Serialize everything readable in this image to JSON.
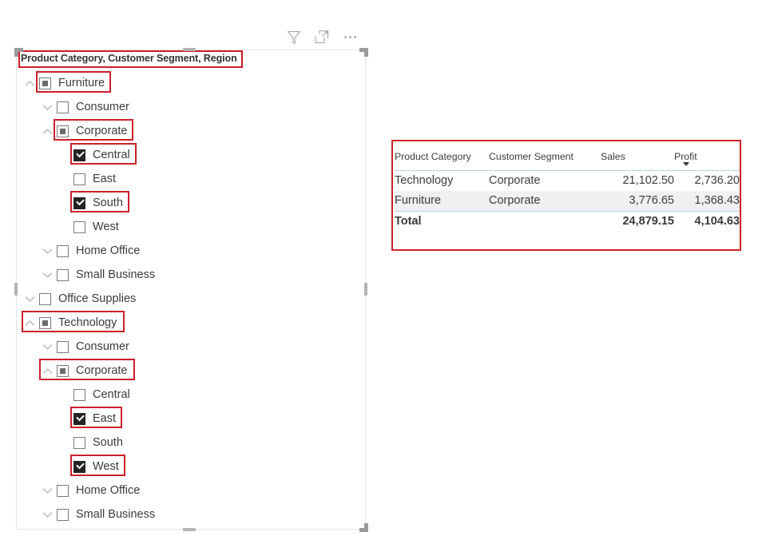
{
  "visual_toolbar": {
    "filter_icon": "filter-funnel-icon",
    "focus_icon": "focus-mode-icon",
    "more_icon": "more-options-icon"
  },
  "slicer": {
    "header": "Product Category, Customer Segment, Region",
    "colors": {
      "annotation": "#cc1f2a",
      "checkbox_checked": "#252423",
      "border": "#e6e6e6"
    },
    "items": [
      {
        "label": "Furniture",
        "level": 1,
        "state": "partial",
        "chevron": "up",
        "annotated": true,
        "anno_includes_chevron": false
      },
      {
        "label": "Consumer",
        "level": 2,
        "state": "unchecked",
        "chevron": "down",
        "annotated": false,
        "anno_includes_chevron": false
      },
      {
        "label": "Corporate",
        "level": 2,
        "state": "partial",
        "chevron": "up",
        "annotated": true,
        "anno_includes_chevron": false
      },
      {
        "label": "Central",
        "level": 3,
        "state": "checked",
        "chevron": "none",
        "annotated": true,
        "anno_includes_chevron": false
      },
      {
        "label": "East",
        "level": 3,
        "state": "unchecked",
        "chevron": "none",
        "annotated": false,
        "anno_includes_chevron": false
      },
      {
        "label": "South",
        "level": 3,
        "state": "checked",
        "chevron": "none",
        "annotated": true,
        "anno_includes_chevron": false
      },
      {
        "label": "West",
        "level": 3,
        "state": "unchecked",
        "chevron": "none",
        "annotated": false,
        "anno_includes_chevron": false
      },
      {
        "label": "Home Office",
        "level": 2,
        "state": "unchecked",
        "chevron": "down",
        "annotated": false,
        "anno_includes_chevron": false
      },
      {
        "label": "Small Business",
        "level": 2,
        "state": "unchecked",
        "chevron": "down",
        "annotated": false,
        "anno_includes_chevron": false
      },
      {
        "label": "Office Supplies",
        "level": 1,
        "state": "unchecked",
        "chevron": "down",
        "annotated": false,
        "anno_includes_chevron": false
      },
      {
        "label": "Technology",
        "level": 1,
        "state": "partial",
        "chevron": "up",
        "annotated": true,
        "anno_includes_chevron": true
      },
      {
        "label": "Consumer",
        "level": 2,
        "state": "unchecked",
        "chevron": "down",
        "annotated": false,
        "anno_includes_chevron": false
      },
      {
        "label": "Corporate",
        "level": 2,
        "state": "partial",
        "chevron": "up",
        "annotated": true,
        "anno_includes_chevron": true
      },
      {
        "label": "Central",
        "level": 3,
        "state": "unchecked",
        "chevron": "none",
        "annotated": false,
        "anno_includes_chevron": false
      },
      {
        "label": "East",
        "level": 3,
        "state": "checked",
        "chevron": "none",
        "annotated": true,
        "anno_includes_chevron": false
      },
      {
        "label": "South",
        "level": 3,
        "state": "unchecked",
        "chevron": "none",
        "annotated": false,
        "anno_includes_chevron": false
      },
      {
        "label": "West",
        "level": 3,
        "state": "checked",
        "chevron": "none",
        "annotated": true,
        "anno_includes_chevron": false
      },
      {
        "label": "Home Office",
        "level": 2,
        "state": "unchecked",
        "chevron": "down",
        "annotated": false,
        "anno_includes_chevron": false
      },
      {
        "label": "Small Business",
        "level": 2,
        "state": "unchecked",
        "chevron": "down",
        "annotated": false,
        "anno_includes_chevron": false
      }
    ]
  },
  "table": {
    "annotated": true,
    "columns": [
      {
        "header": "Product Category",
        "align": "left"
      },
      {
        "header": "Customer Segment",
        "align": "left"
      },
      {
        "header": "Sales",
        "align": "right"
      },
      {
        "header": "Profit",
        "align": "right",
        "sorted": "desc"
      }
    ],
    "rows": [
      {
        "category": "Technology",
        "segment": "Corporate",
        "sales": "21,102.50",
        "profit": "2,736.20",
        "alt": false
      },
      {
        "category": "Furniture",
        "segment": "Corporate",
        "sales": "3,776.65",
        "profit": "1,368.43",
        "alt": true
      }
    ],
    "total": {
      "label": "Total",
      "segment": "",
      "sales": "24,879.15",
      "profit": "4,104.63"
    }
  }
}
